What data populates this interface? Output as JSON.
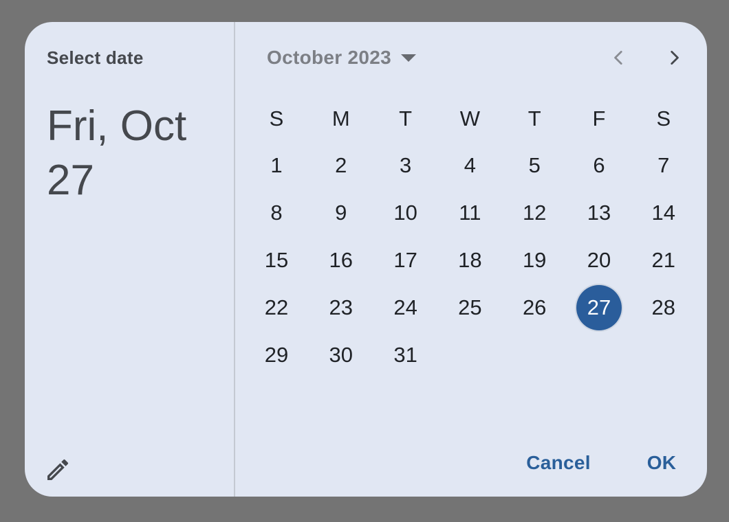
{
  "dialog": {
    "label": "Select date",
    "selected_date_text": "Fri, Oct 27"
  },
  "calendar": {
    "month_label": "October 2023",
    "weekdays": [
      "S",
      "M",
      "T",
      "W",
      "T",
      "F",
      "S"
    ],
    "first_weekday_index": 0,
    "days_in_month": 31,
    "selected_day": 27
  },
  "actions": {
    "cancel_label": "Cancel",
    "ok_label": "OK"
  },
  "icons": {
    "edit": "pencil-icon",
    "prev": "chevron-left-icon",
    "next": "chevron-right-icon",
    "month_dropdown": "caret-down-icon"
  },
  "colors": {
    "accent": "#2a5d9b",
    "surface": "#e1e7f3",
    "backdrop": "#747474"
  }
}
